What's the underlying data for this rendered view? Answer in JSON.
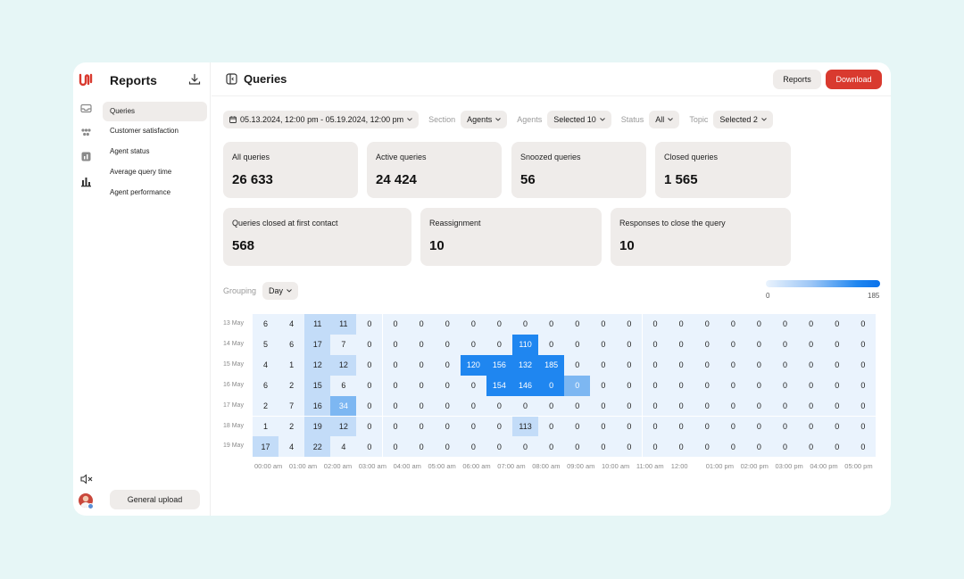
{
  "sidebar": {
    "title": "Reports",
    "items": [
      {
        "label": "Queries",
        "active": true
      },
      {
        "label": "Customer satisfaction",
        "active": false
      },
      {
        "label": "Agent status",
        "active": false
      },
      {
        "label": "Average query time",
        "active": false
      },
      {
        "label": "Agent performance",
        "active": false
      }
    ],
    "upload_label": "General upload"
  },
  "header": {
    "title": "Queries",
    "reports_label": "Reports",
    "download_label": "Download"
  },
  "filters": {
    "date_range": "05.13.2024, 12:00 pm - 05.19.2024, 12:00 pm",
    "section_label": "Section",
    "section_value": "Agents",
    "agents_label": "Agents",
    "agents_value": "Selected 10",
    "status_label": "Status",
    "status_value": "All",
    "topic_label": "Topic",
    "topic_value": "Selected 2"
  },
  "stats": [
    {
      "label": "All queries",
      "value": "26 633"
    },
    {
      "label": "Active queries",
      "value": "24 424"
    },
    {
      "label": "Snoozed queries",
      "value": "56"
    },
    {
      "label": "Closed queries",
      "value": "1 565"
    },
    {
      "label": "Queries closed at first contact",
      "value": "568"
    },
    {
      "label": "Reassignment",
      "value": "10"
    },
    {
      "label": "Responses to close the query",
      "value": "10"
    }
  ],
  "grouping": {
    "label": "Grouping",
    "value": "Day"
  },
  "legend": {
    "min": "0",
    "max": "185"
  },
  "colors": {
    "accent": "#d93a2f",
    "heat_low": "#eaf3fd",
    "heat_high": "#0a72ea",
    "card_bg": "#efecea"
  },
  "chart_data": {
    "type": "heatmap",
    "rows": [
      "13 May",
      "14 May",
      "15 May",
      "16 May",
      "17 May",
      "18 May",
      "19 May"
    ],
    "columns": [
      "00:00 am",
      "01:00 am",
      "02:00 am",
      "03:00 am",
      "04:00 am",
      "05:00 am",
      "06:00 am",
      "07:00 am",
      "08:00 am",
      "09:00 am",
      "10:00 am",
      "11:00 am",
      "12:00",
      "01:00 pm",
      "02:00 pm",
      "03:00 pm",
      "04:00 pm",
      "05:00 pm"
    ],
    "values": [
      [
        6,
        4,
        11,
        11,
        0,
        0,
        0,
        0,
        0,
        0,
        0,
        0,
        0,
        0,
        0,
        0,
        0,
        0,
        0,
        0,
        0,
        0,
        0,
        0
      ],
      [
        5,
        6,
        17,
        7,
        0,
        0,
        0,
        0,
        0,
        0,
        110,
        0,
        0,
        0,
        0,
        0,
        0,
        0,
        0,
        0,
        0,
        0,
        0,
        0
      ],
      [
        4,
        1,
        12,
        12,
        0,
        0,
        0,
        0,
        120,
        156,
        132,
        185,
        0,
        0,
        0,
        0,
        0,
        0,
        0,
        0,
        0,
        0,
        0,
        0
      ],
      [
        6,
        2,
        15,
        6,
        0,
        0,
        0,
        0,
        0,
        154,
        146,
        0,
        0,
        0,
        0,
        0,
        0,
        0,
        0,
        0,
        0,
        0,
        0,
        0
      ],
      [
        2,
        7,
        16,
        34,
        0,
        0,
        0,
        0,
        0,
        0,
        0,
        0,
        0,
        0,
        0,
        0,
        0,
        0,
        0,
        0,
        0,
        0,
        0,
        0
      ],
      [
        1,
        2,
        19,
        12,
        0,
        0,
        0,
        0,
        0,
        0,
        113,
        0,
        0,
        0,
        0,
        0,
        0,
        0,
        0,
        0,
        0,
        0,
        0,
        0
      ],
      [
        17,
        4,
        22,
        4,
        0,
        0,
        0,
        0,
        0,
        0,
        0,
        0,
        0,
        0,
        0,
        0,
        0,
        0,
        0,
        0,
        0,
        0,
        0,
        0
      ]
    ],
    "highlight": [
      [
        0,
        0,
        1,
        1,
        0,
        0,
        0,
        0,
        0,
        0,
        0,
        0,
        0,
        0,
        0,
        0,
        0,
        0,
        0,
        0,
        0,
        0,
        0,
        0
      ],
      [
        0,
        0,
        1,
        0,
        0,
        0,
        0,
        0,
        0,
        0,
        3,
        0,
        0,
        0,
        0,
        0,
        0,
        0,
        0,
        0,
        0,
        0,
        0,
        0
      ],
      [
        0,
        0,
        1,
        1,
        0,
        0,
        0,
        0,
        3,
        3,
        3,
        3,
        0,
        0,
        0,
        0,
        0,
        0,
        0,
        0,
        0,
        0,
        0,
        0
      ],
      [
        0,
        0,
        1,
        0,
        0,
        0,
        0,
        0,
        0,
        3,
        3,
        3,
        2,
        0,
        0,
        0,
        0,
        0,
        0,
        0,
        0,
        0,
        0,
        0
      ],
      [
        0,
        0,
        1,
        2,
        0,
        0,
        0,
        0,
        0,
        0,
        0,
        0,
        0,
        0,
        0,
        0,
        0,
        0,
        0,
        0,
        0,
        0,
        0,
        0
      ],
      [
        0,
        0,
        1,
        1,
        0,
        0,
        0,
        0,
        0,
        0,
        1,
        0,
        0,
        0,
        0,
        0,
        0,
        0,
        0,
        0,
        0,
        0,
        0,
        0
      ],
      [
        1,
        0,
        1,
        0,
        0,
        0,
        0,
        0,
        0,
        0,
        0,
        0,
        0,
        0,
        0,
        0,
        0,
        0,
        0,
        0,
        0,
        0,
        0,
        0
      ]
    ],
    "scale_min": 0,
    "scale_max": 185
  }
}
